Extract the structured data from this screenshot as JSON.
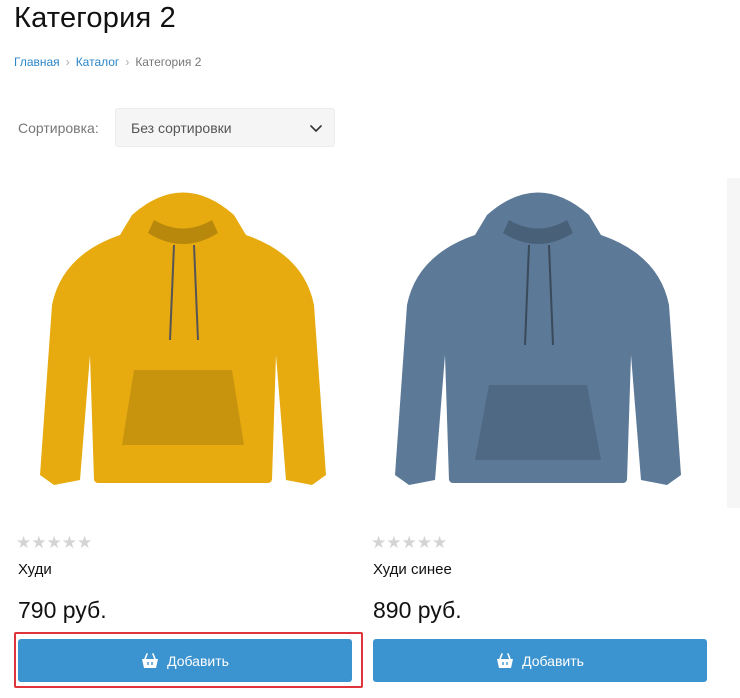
{
  "page": {
    "title": "Категория 2"
  },
  "breadcrumb": {
    "items": [
      {
        "label": "Главная",
        "link": true
      },
      {
        "label": "Каталог",
        "link": true
      },
      {
        "label": "Категория 2",
        "link": false
      }
    ]
  },
  "sort": {
    "label": "Сортировка:",
    "selected": "Без сортировки"
  },
  "products": [
    {
      "name": "Худи",
      "price": "790 руб.",
      "rating_stars": "★★★★★",
      "rating_value": 0,
      "color": "#e7ab10",
      "image_icon": "hoodie-yellow-image",
      "add_label": "Добавить"
    },
    {
      "name": "Худи синее",
      "price": "890 руб.",
      "rating_stars": "★★★★★",
      "rating_value": 0,
      "color": "#5c7998",
      "image_icon": "hoodie-blue-image",
      "add_label": "Добавить"
    }
  ],
  "colors": {
    "accent": "#3b93cf",
    "link": "#2b87c8",
    "highlight": "#e0343c"
  }
}
